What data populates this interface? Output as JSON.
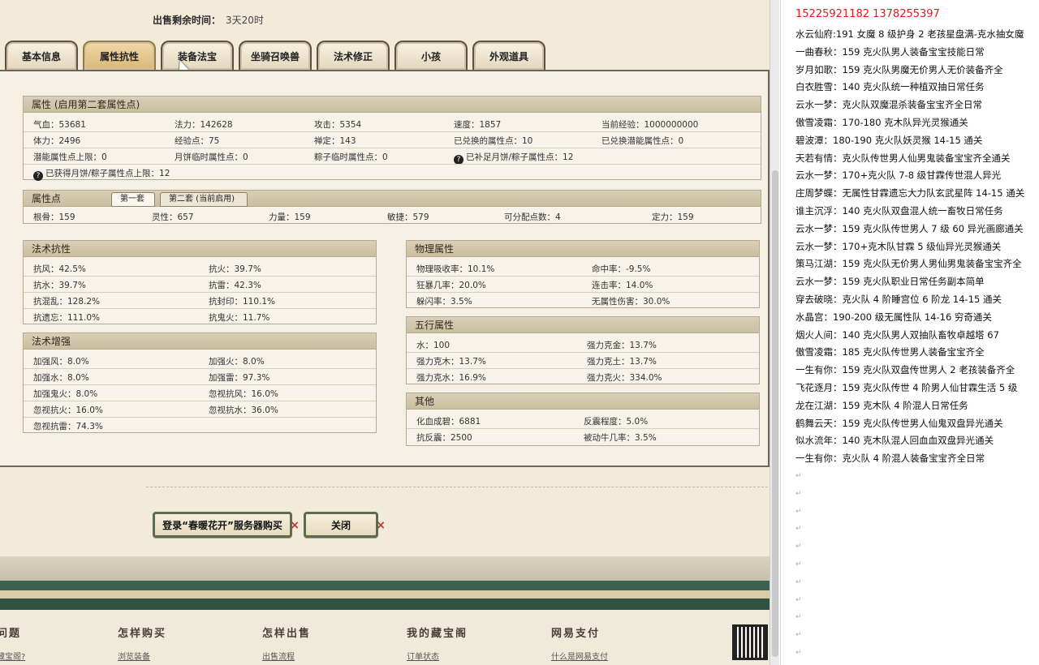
{
  "sale": {
    "label": "出售剩余时间：",
    "value": "3天20时"
  },
  "tabs": [
    "基本信息",
    "属性抗性",
    "装备法宝",
    "坐骑召唤兽",
    "法术修正",
    "小孩",
    "外观道具"
  ],
  "attr": {
    "title": "属性 (启用第二套属性点)",
    "rows": [
      [
        "气血：53681",
        "法力：142628",
        "攻击：5354",
        "速度：1857",
        "当前经验：1000000000"
      ],
      [
        "体力：2496",
        "经验点：75",
        "禅定：143",
        "已兑换的属性点：10",
        "已兑换潜能属性点：0"
      ],
      [
        "潜能属性点上限：0",
        "月饼临时属性点：0",
        "粽子临时属性点：0",
        "已补足月饼/粽子属性点：12"
      ]
    ],
    "extra": "已获得月饼/粽子属性点上限：12"
  },
  "points": {
    "title": "属性点",
    "subtabs": [
      "第一套",
      "第二套 (当前启用)"
    ],
    "values": [
      "根骨：159",
      "灵性：657",
      "力量：159",
      "敏捷：579",
      "可分配点数：4",
      "定力：159"
    ]
  },
  "resist": {
    "title": "法术抗性",
    "cells": [
      "抗风：42.5%",
      "抗火：39.7%",
      "抗水：39.7%",
      "抗雷：42.3%",
      "抗混乱：128.2%",
      "抗封印：110.1%",
      "抗遗忘：111.0%",
      "抗鬼火：11.7%"
    ]
  },
  "enhance": {
    "title": "法术增强",
    "cells": [
      "加强风：8.0%",
      "加强火：8.0%",
      "加强水：8.0%",
      "加强雷：97.3%",
      "加强鬼火：8.0%",
      "忽视抗风：16.0%",
      "忽视抗火：16.0%",
      "忽视抗水：36.0%",
      "忽视抗雷：74.3%"
    ]
  },
  "physical": {
    "title": "物理属性",
    "cells": [
      "物理吸收率：10.1%",
      "命中率：-9.5%",
      "狂暴几率：20.0%",
      "连击率：14.0%",
      "躲闪率：3.5%",
      "无属性伤害：30.0%"
    ]
  },
  "elements": {
    "title": "五行属性",
    "cells": [
      "水：100",
      "强力克金：13.7%",
      "强力克木：13.7%",
      "强力克土：13.7%",
      "强力克水：16.9%",
      "强力克火：334.0%"
    ]
  },
  "other": {
    "title": "其他",
    "cells": [
      "化血成碧：6881",
      "反震程度：5.0%",
      "抗反震：2500",
      "被动牛几率：3.5%"
    ]
  },
  "buttons": {
    "login": "登录“春暖花开”服务器购买",
    "close": "关闭"
  },
  "footer": [
    {
      "title": "问题",
      "link": "藏宝阁?"
    },
    {
      "title": "怎样购买",
      "link": "浏览装备"
    },
    {
      "title": "怎样出售",
      "link": "出售流程"
    },
    {
      "title": "我的藏宝阁",
      "link": "订单状态"
    },
    {
      "title": "网易支付",
      "link": "什么是网易支付"
    }
  ],
  "notes": {
    "phones": "15225921182    1378255397",
    "lines": [
      "水云仙府:191 女魔 8 级护身 2 老孩星盘满-克水抽女魔",
      "一曲春秋：159 克火队男人装备宝宝技能日常",
      "岁月如歌：159 克火队男魔无价男人无价装备齐全",
      "白衣胜雪：140 克火队统一种植双抽日常任务",
      "云水一梦：克火队双魔混杀装备宝宝齐全日常",
      "傲雪凌霜：170-180 克木队异光灵猴通关",
      "碧波潭：180-190 克火队妖灵猴 14-15 通关",
      "天若有情：克火队传世男人仙男鬼装备宝宝齐全通关",
      "云水一梦：170+克火队 7-8 级甘霖传世混人异光",
      "庄周梦蝶：无属性甘霖遗忘大力队玄武星阵 14-15 通关",
      "谁主沉浮：140 克火队双盘混人统一畜牧日常任务",
      "云水一梦：159 克火队传世男人 7 级 60 异光画廊通关",
      "云水一梦：170+克木队甘霖 5 级仙异光灵猴通关",
      "策马江湖：159 克火队无价男人男仙男鬼装备宝宝齐全",
      "云水一梦：159 克火队职业日常任务副本简单",
      "穿去破晓：克火队 4 阶睡宫位 6 阶龙 14-15 通关",
      "水晶宫：190-200 级无属性队 14-16 穷奇通关",
      "烟火人间：140 克火队男人双抽队畜牧卓越塔 67",
      "傲雪凌霜：185 克火队传世男人装备宝宝齐全",
      "一生有你：159 克火队双盘传世男人 2 老孩装备齐全",
      "飞花逐月：159 克火队传世 4 阶男人仙甘霖生活 5 级",
      "龙在江湖：159 克木队 4 阶混人日常任务",
      "鹤舞云天：159 克火队传世男人仙鬼双盘异光通关",
      "似水流年：140 克木队混人回血血双盘异光通关",
      "一生有你：克火队 4 阶混人装备宝宝齐全日常"
    ]
  }
}
